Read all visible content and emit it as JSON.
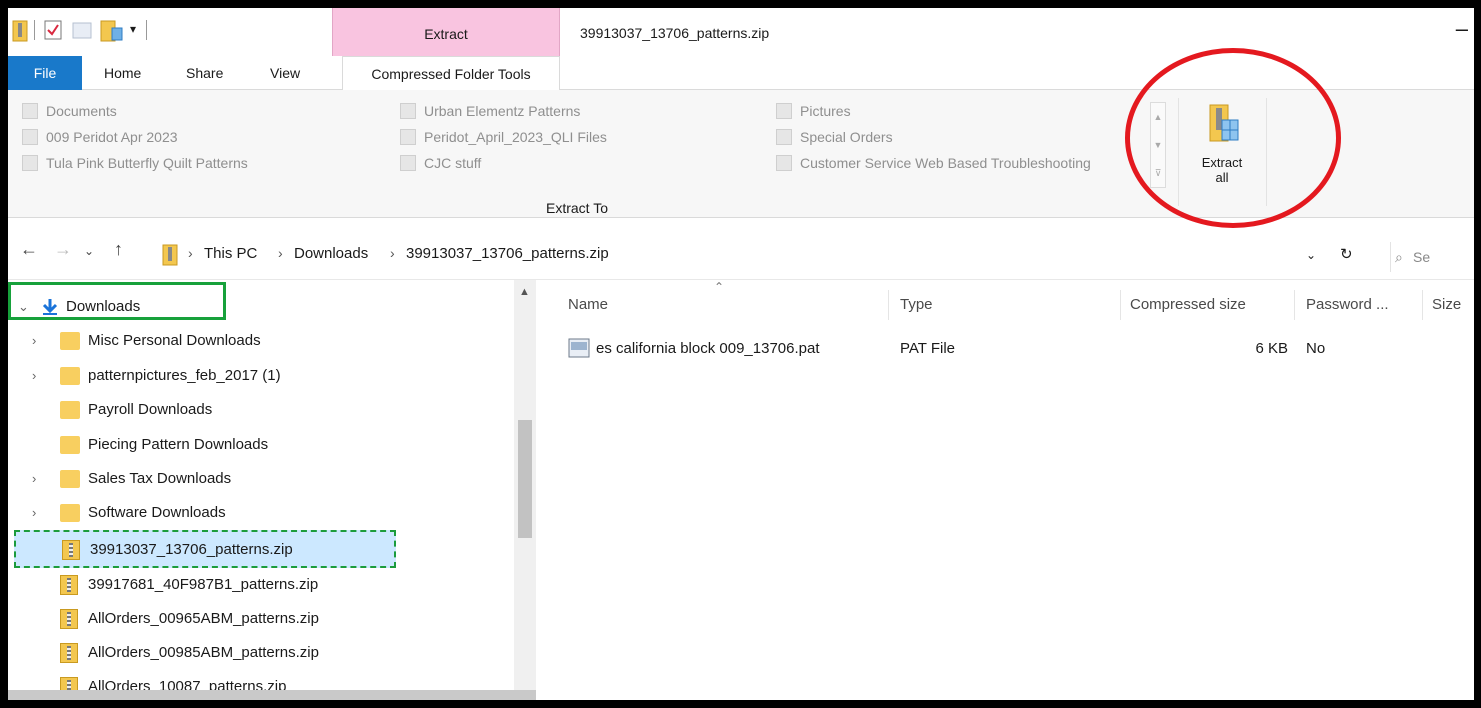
{
  "window": {
    "title": "39913037_13706_patterns.zip",
    "context_tab": "Extract"
  },
  "tabs": {
    "file": "File",
    "home": "Home",
    "share": "Share",
    "view": "View",
    "compressed": "Compressed Folder Tools"
  },
  "ribbon": {
    "destinations_col1": [
      "Documents",
      "009 Peridot Apr 2023",
      "Tula Pink Butterfly Quilt Patterns"
    ],
    "destinations_col2": [
      "Urban Elementz Patterns",
      "Peridot_April_2023_QLI Files",
      "CJC stuff"
    ],
    "destinations_col3": [
      "Pictures",
      "Special Orders",
      "Customer Service Web Based Troubleshooting"
    ],
    "extract_to_label": "Extract To",
    "extract_all_line1": "Extract",
    "extract_all_line2": "all"
  },
  "address": {
    "crumbs": [
      "This PC",
      "Downloads",
      "39913037_13706_patterns.zip"
    ],
    "search_placeholder": "Se"
  },
  "navpane": {
    "root": "Downloads",
    "items": [
      {
        "label": "Misc Personal Downloads"
      },
      {
        "label": "patternpictures_feb_2017 (1)"
      },
      {
        "label": "Payroll Downloads"
      },
      {
        "label": "Piecing Pattern Downloads"
      },
      {
        "label": "Sales Tax Downloads"
      },
      {
        "label": "Software Downloads"
      },
      {
        "label": "39913037_13706_patterns.zip"
      },
      {
        "label": "39917681_40F987B1_patterns.zip"
      },
      {
        "label": "AllOrders_00965ABM_patterns.zip"
      },
      {
        "label": "AllOrders_00985ABM_patterns.zip"
      },
      {
        "label": "AllOrders_10087_patterns.zip"
      }
    ]
  },
  "table": {
    "headers": [
      "Name",
      "Type",
      "Compressed size",
      "Password ...",
      "Size"
    ],
    "rows": [
      {
        "name": "es california block 009_13706.pat",
        "type": "PAT File",
        "compressed": "6 KB",
        "password": "No"
      }
    ]
  },
  "colors": {
    "accent": "#1979ca",
    "context_tab": "#f9c4e0",
    "annotation_red": "#e4191f",
    "annotation_green": "#17a13b"
  }
}
